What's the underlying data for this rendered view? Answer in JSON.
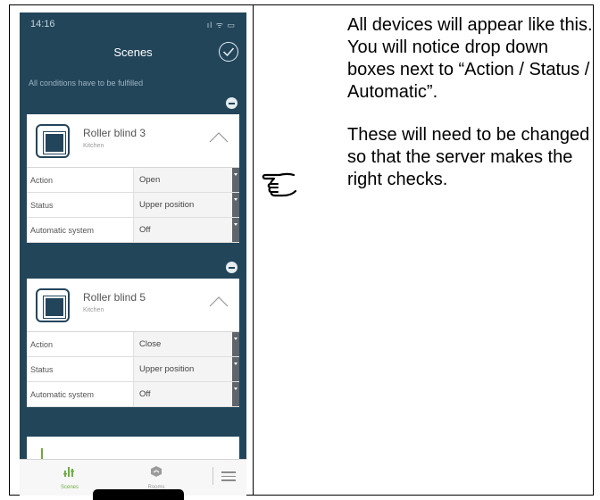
{
  "phone": {
    "status_bar": {
      "time": "14:16",
      "indicators": "ıl ᯤ ▭"
    },
    "nav": {
      "title": "Scenes",
      "confirm_icon": "check-circle-icon"
    },
    "hint": "All conditions have to be fulfilled",
    "devices": [
      {
        "name": "Roller blind 3",
        "room": "Kitchen",
        "icon": "roller-blind-icon",
        "rows": [
          {
            "label": "Action",
            "value": "Open"
          },
          {
            "label": "Status",
            "value": "Upper position"
          },
          {
            "label": "Automatic system",
            "value": "Off"
          }
        ]
      },
      {
        "name": "Roller blind 5",
        "room": "Kitchen",
        "icon": "roller-blind-icon",
        "rows": [
          {
            "label": "Action",
            "value": "Close"
          },
          {
            "label": "Status",
            "value": "Upper position"
          },
          {
            "label": "Automatic system",
            "value": "Off"
          }
        ]
      }
    ],
    "tabs": [
      {
        "label": "Scenes",
        "icon": "scenes-icon",
        "active": true
      },
      {
        "label": "Rooms",
        "icon": "rooms-icon",
        "active": false
      }
    ],
    "menu_icon": "hamburger-menu-icon"
  },
  "pointer_icon": "pointing-hand-icon",
  "instructions": {
    "paragraph1": "All devices will appear like this. You will notice drop down boxes next to “Action / Status / Automatic”.",
    "paragraph2": "These will need to be changed so that the server makes the right checks."
  },
  "colors": {
    "phone_background": "#22455a",
    "accent_green": "#6fae44",
    "dropdown_arrow": "#5f656a"
  }
}
